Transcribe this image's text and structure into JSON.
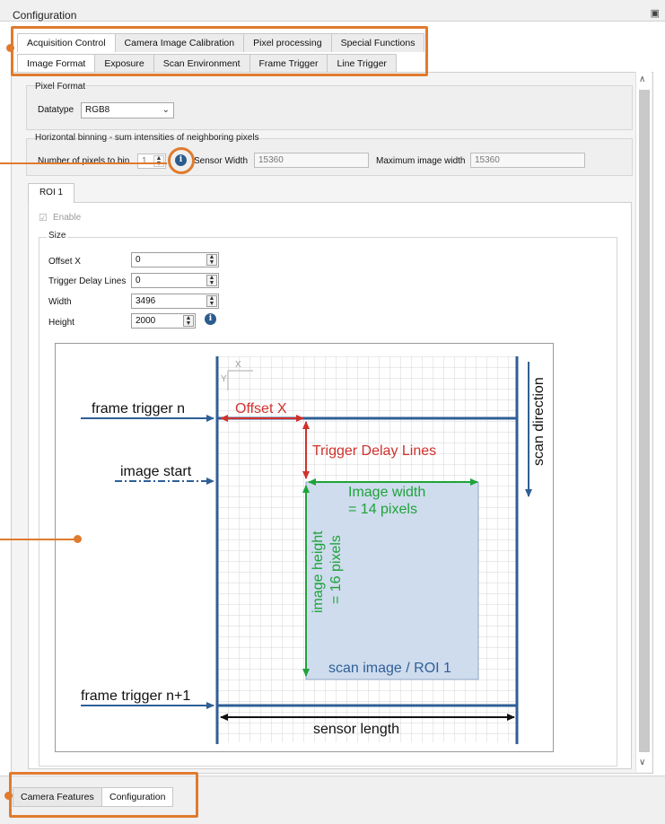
{
  "window": {
    "title": "Configuration",
    "pin_glyph": "ᴮ"
  },
  "tabs_row1": [
    "Acquisition Control",
    "Camera Image Calibration",
    "Pixel processing",
    "Special Functions"
  ],
  "tabs_row2": [
    "Image Format",
    "Exposure",
    "Scan Environment",
    "Frame Trigger",
    "Line Trigger"
  ],
  "pixel_format": {
    "group_label": "Pixel Format",
    "datatype_label": "Datatype",
    "datatype_value": "RGB8"
  },
  "binning": {
    "group_label": "Horizontal binning - sum intensities of neighboring pixels",
    "pixels_label": "Number of pixels to bin",
    "pixels_value": "1",
    "sensor_width_label": "Sensor Width",
    "sensor_width_value": "15360",
    "max_width_label": "Maximum image width",
    "max_width_value": "15360"
  },
  "roi": {
    "tab_label": "ROI 1",
    "enable_label": "Enable",
    "size_group_label": "Size",
    "fields": [
      {
        "label": "Offset X",
        "value": "0"
      },
      {
        "label": "Trigger Delay Lines",
        "value": "0"
      },
      {
        "label": "Width",
        "value": "3496"
      },
      {
        "label": "Height",
        "value": "2000"
      }
    ]
  },
  "diagram": {
    "frame_trigger_n": "frame trigger n",
    "image_start": "image start",
    "frame_trigger_n1": "frame trigger n+1",
    "offset_x": "Offset X",
    "trigger_delay_lines": "Trigger Delay Lines",
    "image_width_line1": "Image width",
    "image_width_line2": "= 14 pixels",
    "image_height_line1": "image height",
    "image_height_line2": "= 16 pixels",
    "scan_image": "scan image / ROI 1",
    "sensor_length": "sensor length",
    "scan_direction": "scan direction",
    "axis_x": "X",
    "axis_y": "Y"
  },
  "bottom_tabs": [
    "Camera Features",
    "Configuration"
  ],
  "colors": {
    "highlight": "#e07b2e",
    "red": "#d0312d",
    "green": "#1fa33a",
    "blue": "#2f5f96",
    "roi_fill": "#cfdcee"
  }
}
